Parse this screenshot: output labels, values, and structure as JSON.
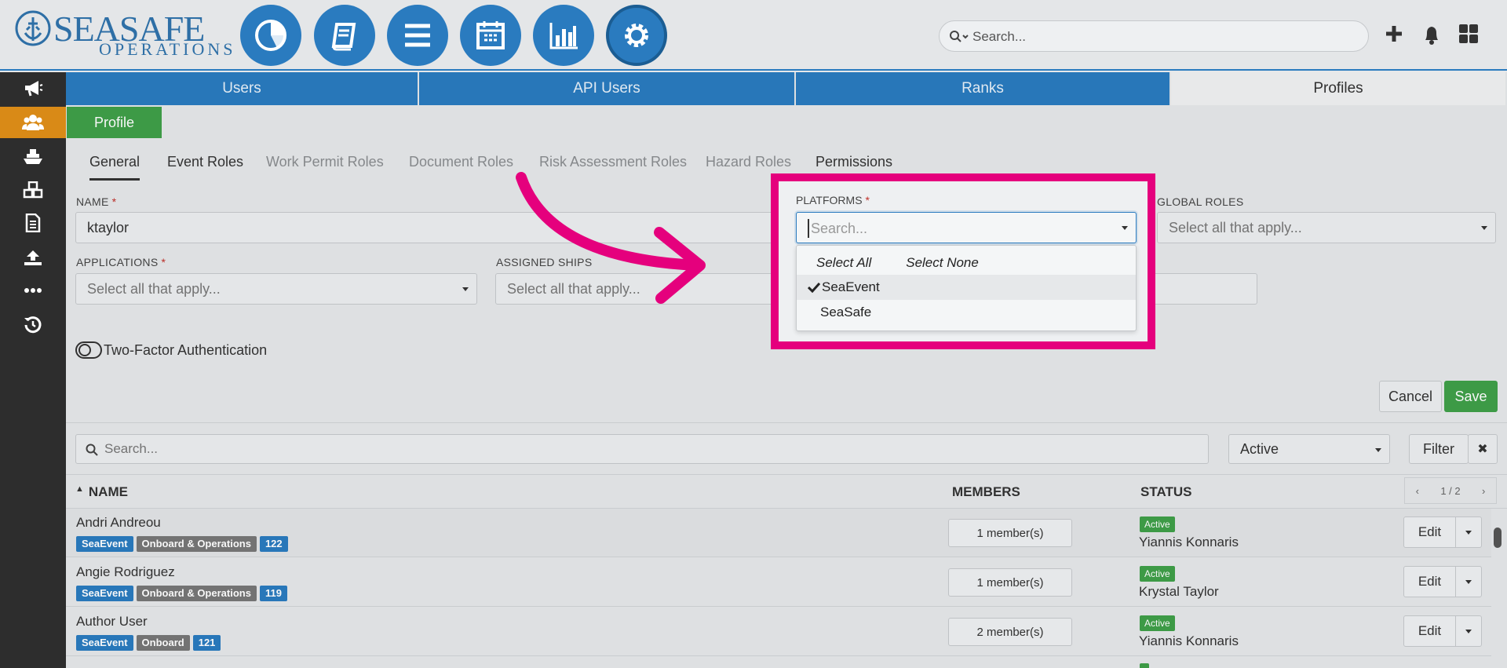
{
  "brand": {
    "name": "SEASAFE",
    "sub": "OPERATIONS"
  },
  "topnav": {
    "icons": [
      "pie-chart-icon",
      "book-icon",
      "menu-icon",
      "calendar-icon",
      "bar-chart-icon",
      "gear-icon"
    ],
    "search_placeholder": "Search...",
    "actions": [
      "plus-icon",
      "bell-icon",
      "grid-icon"
    ]
  },
  "sidebar": {
    "items": [
      "megaphone-icon",
      "users-icon",
      "ship-icon",
      "cubes-icon",
      "document-icon",
      "upload-icon",
      "more-icon",
      "history-icon"
    ],
    "active_index": 1
  },
  "tabs": [
    "Users",
    "API Users",
    "Ranks",
    "Profiles"
  ],
  "active_tab": "Profiles",
  "profile_button": "Profile",
  "subtabs": [
    {
      "label": "General",
      "state": "selected"
    },
    {
      "label": "Event Roles",
      "state": "enabled"
    },
    {
      "label": "Work Permit Roles",
      "state": "disabled"
    },
    {
      "label": "Document Roles",
      "state": "disabled"
    },
    {
      "label": "Risk Assessment Roles",
      "state": "disabled"
    },
    {
      "label": "Hazard Roles",
      "state": "disabled"
    },
    {
      "label": "Permissions",
      "state": "enabled"
    }
  ],
  "form": {
    "name_label": "NAME",
    "name_value": "ktaylor",
    "platforms_label": "PLATFORMS",
    "platforms_placeholder": "Search...",
    "global_roles_label": "GLOBAL ROLES",
    "global_roles_placeholder": "Select all that apply...",
    "applications_label": "APPLICATIONS",
    "applications_placeholder": "Select all that apply...",
    "assigned_ships_label": "ASSIGNED SHIPS",
    "assigned_ships_placeholder": "Select all that apply...",
    "two_factor_label": "Two-Factor Authentication",
    "cancel_label": "Cancel",
    "save_label": "Save"
  },
  "platforms_dropdown": {
    "select_all": "Select All",
    "select_none": "Select None",
    "options": [
      {
        "label": "SeaEvent",
        "checked": true
      },
      {
        "label": "SeaSafe",
        "checked": false
      }
    ]
  },
  "list": {
    "search_placeholder": "Search...",
    "status_filter": "Active",
    "filter_label": "Filter",
    "clear_label": "✖",
    "columns": [
      "NAME",
      "MEMBERS",
      "STATUS"
    ],
    "pager": "1 / 2",
    "rows": [
      {
        "name": "Andri Andreou",
        "tags": [
          "SeaEvent",
          "Onboard & Operations",
          "122"
        ],
        "members": "1 member(s)",
        "status": "Active",
        "person": "Yiannis Konnaris",
        "action": "Edit"
      },
      {
        "name": "Angie Rodriguez",
        "tags": [
          "SeaEvent",
          "Onboard & Operations",
          "119"
        ],
        "members": "1 member(s)",
        "status": "Active",
        "person": "Krystal Taylor",
        "action": "Edit"
      },
      {
        "name": "Author User",
        "tags": [
          "SeaEvent",
          "Onboard",
          "121"
        ],
        "members": "2 member(s)",
        "status": "Active",
        "person": "Yiannis Konnaris",
        "action": "Edit"
      }
    ]
  },
  "colors": {
    "primary": "#2a7bbf",
    "success": "#3f9f49",
    "highlight": "#e5007d",
    "sidebar_active": "#d98a17"
  }
}
